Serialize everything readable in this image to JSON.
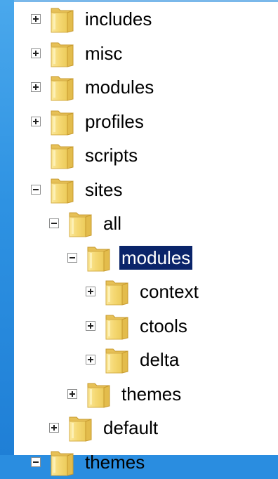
{
  "tree": {
    "items": [
      {
        "label": "includes",
        "toggle": "plus",
        "depth": 0
      },
      {
        "label": "misc",
        "toggle": "plus",
        "depth": 0
      },
      {
        "label": "modules",
        "toggle": "plus",
        "depth": 0
      },
      {
        "label": "profiles",
        "toggle": "plus",
        "depth": 0
      },
      {
        "label": "scripts",
        "toggle": "none",
        "depth": 0
      },
      {
        "label": "sites",
        "toggle": "minus",
        "depth": 0
      },
      {
        "label": "all",
        "toggle": "minus",
        "depth": 1
      },
      {
        "label": "modules",
        "toggle": "minus",
        "depth": 2,
        "selected": true
      },
      {
        "label": "context",
        "toggle": "plus",
        "depth": 3
      },
      {
        "label": "ctools",
        "toggle": "plus",
        "depth": 3
      },
      {
        "label": "delta",
        "toggle": "plus",
        "depth": 3
      },
      {
        "label": "themes",
        "toggle": "plus",
        "depth": 2
      },
      {
        "label": "default",
        "toggle": "plus",
        "depth": 1
      },
      {
        "label": "themes",
        "toggle": "minus",
        "depth": 0
      }
    ]
  },
  "colors": {
    "selection": "#0a246a",
    "folder": "#f2d36a"
  }
}
